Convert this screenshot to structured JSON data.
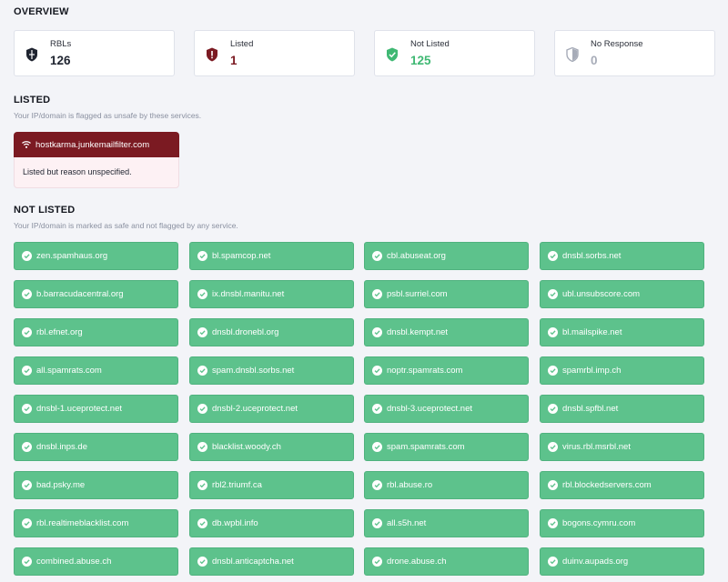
{
  "overview": {
    "title": "OVERVIEW",
    "cards": [
      {
        "label": "RBLs",
        "value": "126",
        "icon": "shield-dark-icon",
        "color": "#1f2430"
      },
      {
        "label": "Listed",
        "value": "1",
        "icon": "shield-alert-icon",
        "color": "#7b1a22"
      },
      {
        "label": "Not Listed",
        "value": "125",
        "icon": "shield-check-icon",
        "color": "#3fb873"
      },
      {
        "label": "No Response",
        "value": "0",
        "icon": "shield-half-icon",
        "color": "#a7acb8"
      }
    ]
  },
  "listed": {
    "title": "LISTED",
    "subtitle": "Your IP/domain is flagged as unsafe by these services.",
    "items": [
      {
        "name": "hostkarma.junkemailfilter.com",
        "reason": "Listed but reason unspecified.",
        "icon": "signal-icon"
      }
    ]
  },
  "not_listed": {
    "title": "NOT LISTED",
    "subtitle": "Your IP/domain is marked as safe and not flagged by any service.",
    "icon": "check-circle-icon",
    "items": [
      "zen.spamhaus.org",
      "bl.spamcop.net",
      "cbl.abuseat.org",
      "dnsbl.sorbs.net",
      "b.barracudacentral.org",
      "ix.dnsbl.manitu.net",
      "psbl.surriel.com",
      "ubl.unsubscore.com",
      "rbl.efnet.org",
      "dnsbl.dronebl.org",
      "dnsbl.kempt.net",
      "bl.mailspike.net",
      "all.spamrats.com",
      "spam.dnsbl.sorbs.net",
      "noptr.spamrats.com",
      "spamrbl.imp.ch",
      "dnsbl-1.uceprotect.net",
      "dnsbl-2.uceprotect.net",
      "dnsbl-3.uceprotect.net",
      "dnsbl.spfbl.net",
      "dnsbl.inps.de",
      "blacklist.woody.ch",
      "spam.spamrats.com",
      "virus.rbl.msrbl.net",
      "bad.psky.me",
      "rbl2.triumf.ca",
      "rbl.abuse.ro",
      "rbl.blockedservers.com",
      "rbl.realtimeblacklist.com",
      "db.wpbl.info",
      "all.s5h.net",
      "bogons.cymru.com",
      "combined.abuse.ch",
      "dnsbl.anticaptcha.net",
      "drone.abuse.ch",
      "duinv.aupads.org"
    ]
  }
}
